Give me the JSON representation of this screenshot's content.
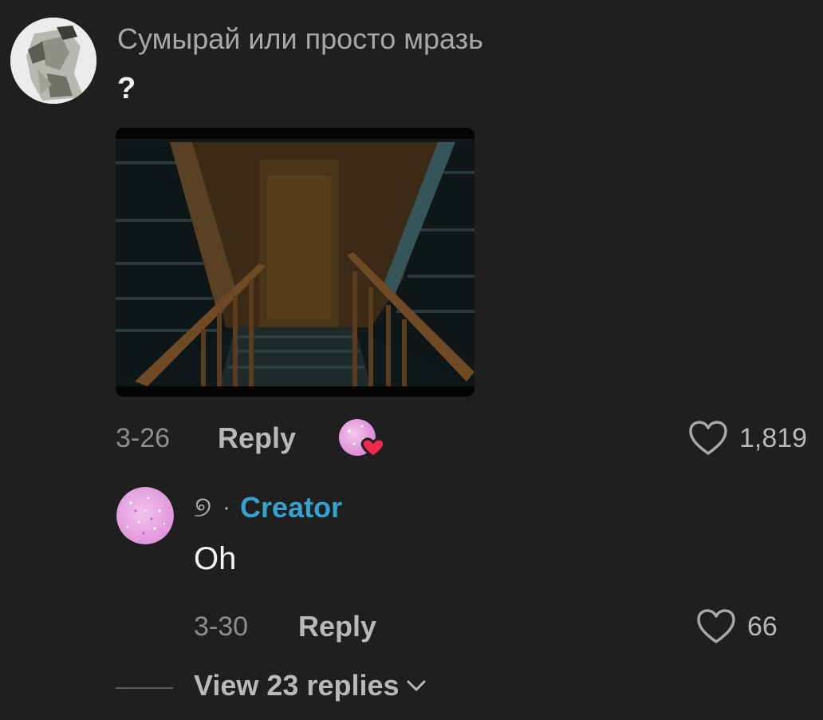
{
  "comment": {
    "username": "Сумырай или просто мразь",
    "text": "?",
    "date": "3-26",
    "reply_label": "Reply",
    "like_count": "1,819",
    "attachment_icon": "staircase-photo",
    "creator_liked": true
  },
  "reply": {
    "username": "୭",
    "separator": "·",
    "badge": "Creator",
    "text": "Oh",
    "date": "3-30",
    "reply_label": "Reply",
    "like_count": "66"
  },
  "view_replies": {
    "label": "View 23 replies",
    "icon": "chevron-down-icon"
  },
  "colors": {
    "background": "#1f1f1f",
    "creator_accent": "#35a3cf",
    "heart_red": "#f0294f"
  }
}
